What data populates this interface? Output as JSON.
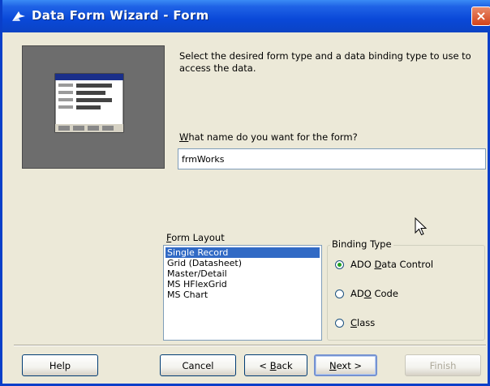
{
  "window": {
    "title": "Data Form Wizard - Form",
    "close_label": "×"
  },
  "instructions": "Select the desired form type and a data binding type to use to access the data.",
  "form_name": {
    "label_prefix": "",
    "label_accel": "W",
    "label_rest": "hat name do you want for the form?",
    "value": "frmWorks"
  },
  "form_layout": {
    "label_accel": "F",
    "label_rest": "orm Layout",
    "items": [
      {
        "label": "Single Record",
        "selected": true
      },
      {
        "label": "Grid (Datasheet)",
        "selected": false
      },
      {
        "label": "Master/Detail",
        "selected": false
      },
      {
        "label": "MS HFlexGrid",
        "selected": false
      },
      {
        "label": "MS Chart",
        "selected": false
      }
    ]
  },
  "binding_type": {
    "legend": "Binding Type",
    "options": [
      {
        "prefix": "ADO ",
        "accel": "D",
        "rest": "ata Control",
        "checked": true
      },
      {
        "prefix": "AD",
        "accel": "O",
        "rest": " Code",
        "checked": false
      },
      {
        "prefix": "",
        "accel": "C",
        "rest": "lass",
        "checked": false
      }
    ]
  },
  "buttons": {
    "help": "Help",
    "cancel": "Cancel",
    "back_prefix": "< ",
    "back_accel": "B",
    "back_rest": "ack",
    "next_accel": "N",
    "next_rest": "ext >",
    "finish": "Finish"
  },
  "colors": {
    "title_bar": "#0a48d8",
    "selection": "#316ac5",
    "dialog_bg": "#ece9d8",
    "close_button": "#d3421a"
  }
}
